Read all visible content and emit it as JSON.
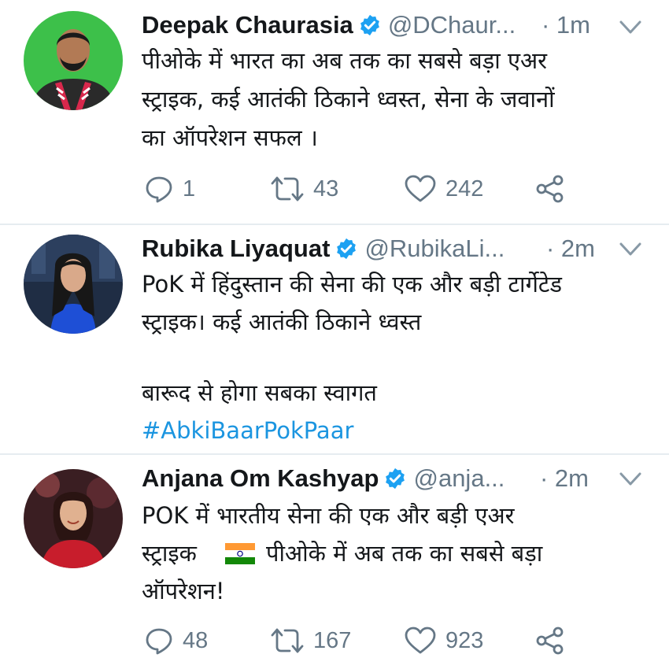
{
  "colors": {
    "text": "#14171a",
    "secondary": "#657786",
    "link": "#1b95e0",
    "verified": "#1da1f2"
  },
  "tweets": [
    {
      "name": "Deepak Chaurasia",
      "handle": "@DChaur...",
      "time": "· 1m",
      "lines": [
        "पीओके में भारत का अब तक का सबसे बड़ा एअर",
        "स्ट्राइक, कई आतंकी ठिकाने ध्वस्त,  सेना के जवानों",
        "का ऑपरेशन सफल ।"
      ],
      "replies": "1",
      "retweets": "43",
      "likes": "242"
    },
    {
      "name": "Rubika Liyaquat",
      "handle": "@RubikaLi...",
      "time": "· 2m",
      "lines": [
        "PoK में हिंदुस्तान की सेना की एक और बड़ी टार्गेटेड",
        "स्ट्राइक। कई आतंकी ठिकाने ध्वस्त",
        "",
        "बारूद से होगा सबका स्वागत"
      ],
      "hashtag": "#AbkiBaarPokPaar"
    },
    {
      "name": "Anjana Om Kashyap",
      "handle": "@anja...",
      "time": "· 2m",
      "lines": [
        "POK में भारतीय सेना की एक और बड़ी एअर",
        "स्ट्राइक",
        "पीओके में अब तक का सबसे बड़ा",
        "ऑपरेशन!"
      ],
      "replies": "48",
      "retweets": "167",
      "likes": "923"
    }
  ],
  "icons": {
    "reply": "speech-bubble-icon",
    "retweet": "retweet-arrows-icon",
    "like": "heart-icon",
    "share": "share-icon",
    "verified": "verified-badge-icon",
    "caret": "chevron-down-icon",
    "flag": "india-flag-emoji"
  }
}
